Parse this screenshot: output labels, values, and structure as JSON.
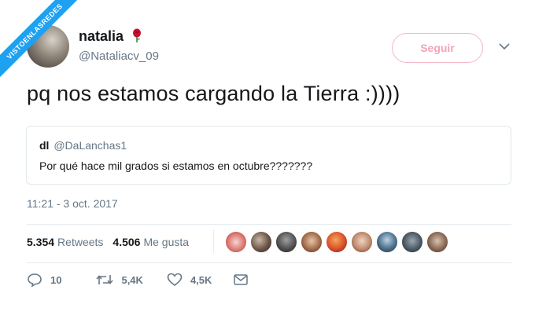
{
  "watermark": {
    "text": "VISTOENLASREDES"
  },
  "author": {
    "display_name": "natalia",
    "handle": "@Nataliacv_09",
    "follow_label": "Seguir"
  },
  "tweet": {
    "text": "pq nos estamos cargando la Tierra :))))",
    "timestamp": "11:21 - 3 oct. 2017"
  },
  "quoted": {
    "name": "dl",
    "handle": "@DaLanchas1",
    "text": "Por qué hace mil grados si estamos en octubre???????"
  },
  "stats": {
    "retweets_count": "5.354",
    "retweets_label": "Retweets",
    "likes_count": "4.506",
    "likes_label": "Me gusta"
  },
  "actions": {
    "reply_count": "10",
    "retweet_count": "5,4K",
    "like_count": "4,5K"
  },
  "colors": {
    "accent": "#1da1f2",
    "follow_pink": "#f4a3b6",
    "muted": "#657786"
  }
}
